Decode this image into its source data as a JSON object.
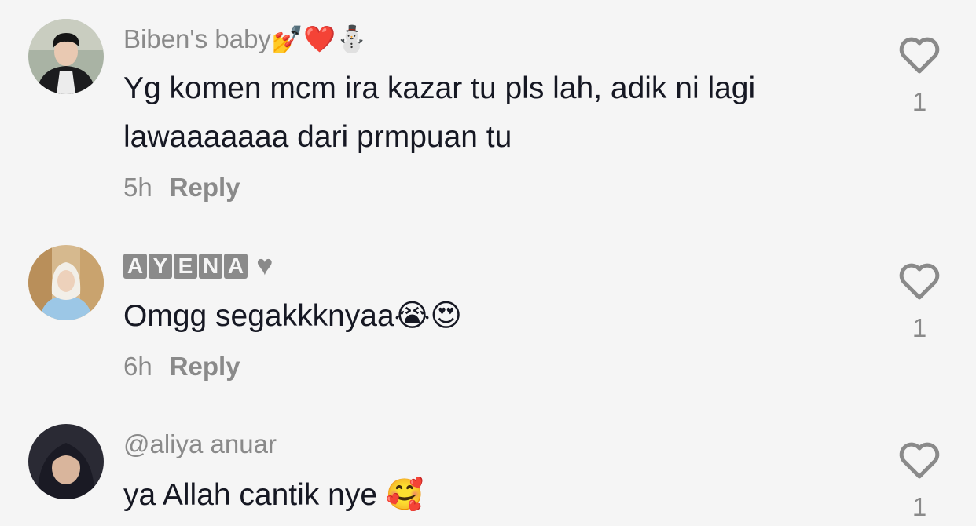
{
  "comments": [
    {
      "username": "Biben's baby",
      "username_emojis": "💅❤️⛄",
      "text_line1": "Yg komen mcm ira kazar tu pls lah, adik ni lagi",
      "text_line2": "lawaaaaaaa dari prmpuan tu",
      "time": "5h",
      "reply_label": "Reply",
      "likes": "1"
    },
    {
      "username_letters": [
        "A",
        "Y",
        "E",
        "N",
        "A"
      ],
      "username_suffix": "♥",
      "text": "Omgg segakkknyaa",
      "text_emojis": "😭😍",
      "time": "6h",
      "reply_label": "Reply",
      "likes": "1"
    },
    {
      "username": "@aliya anuar",
      "text": "ya Allah cantik nye",
      "text_emojis": "🥰",
      "likes": "1"
    }
  ],
  "icons": {
    "like": "heart-outline-icon"
  },
  "colors": {
    "background": "#f5f5f5",
    "text": "#161823",
    "muted": "#8a8a8a"
  }
}
